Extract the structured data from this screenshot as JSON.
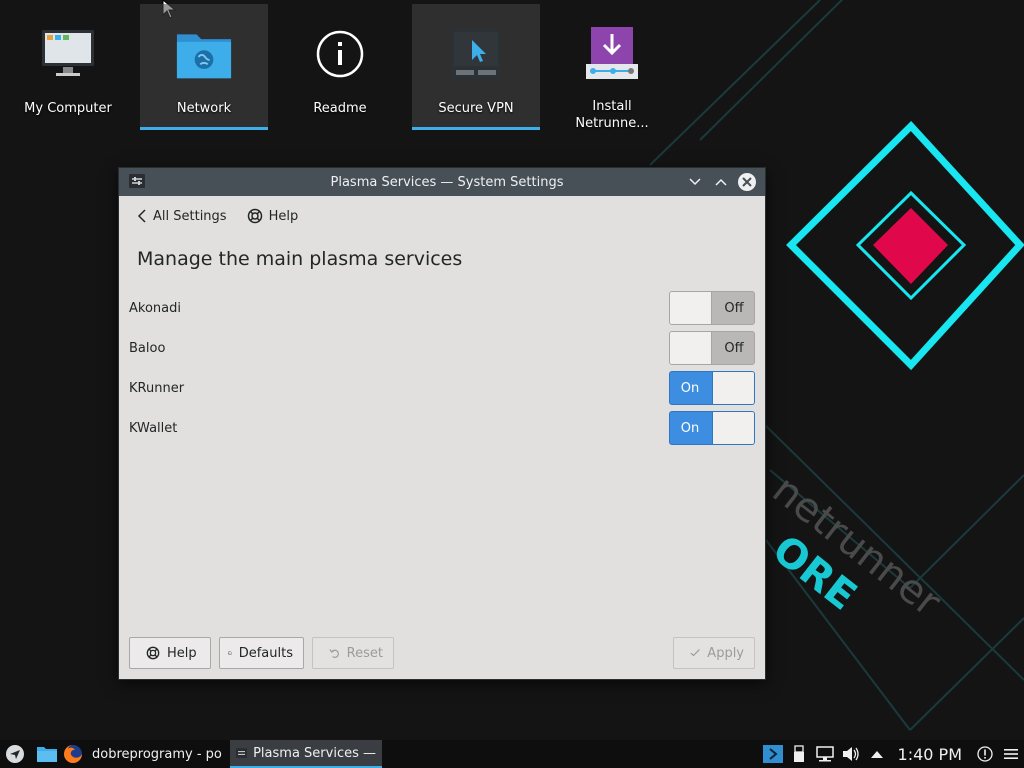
{
  "desktop": {
    "icons": [
      {
        "label": "My Computer",
        "icon": "computer-icon"
      },
      {
        "label": "Network",
        "icon": "network-folder-icon"
      },
      {
        "label": "Readme",
        "icon": "info-icon"
      },
      {
        "label": "Secure VPN",
        "icon": "vpn-icon"
      },
      {
        "label": "Install Netrunne...",
        "icon": "installer-icon"
      }
    ],
    "wallpaper_text": "netrunner",
    "wallpaper_text2": "ORE"
  },
  "window": {
    "title": "Plasma Services  — System Settings",
    "nav": {
      "back_label": "All Settings",
      "help_label": "Help"
    },
    "heading": "Manage the main plasma services",
    "services": [
      {
        "name": "Akonadi",
        "state": "Off"
      },
      {
        "name": "Baloo",
        "state": "Off"
      },
      {
        "name": "KRunner",
        "state": "On"
      },
      {
        "name": "KWallet",
        "state": "On"
      }
    ],
    "footer": {
      "help": "Help",
      "defaults": "Defaults",
      "reset": "Reset",
      "apply": "Apply"
    }
  },
  "taskbar": {
    "tasks": [
      {
        "label": "dobreprogramy - po"
      },
      {
        "label": "Plasma Services  —"
      }
    ],
    "clock": "1:40 PM"
  },
  "colors": {
    "accent": "#3daee9",
    "toggle_on": "#3d8ee0",
    "titlebar": "#475057",
    "wallpaper_cyan": "#18e6f0",
    "wallpaper_red": "#e0084a"
  }
}
